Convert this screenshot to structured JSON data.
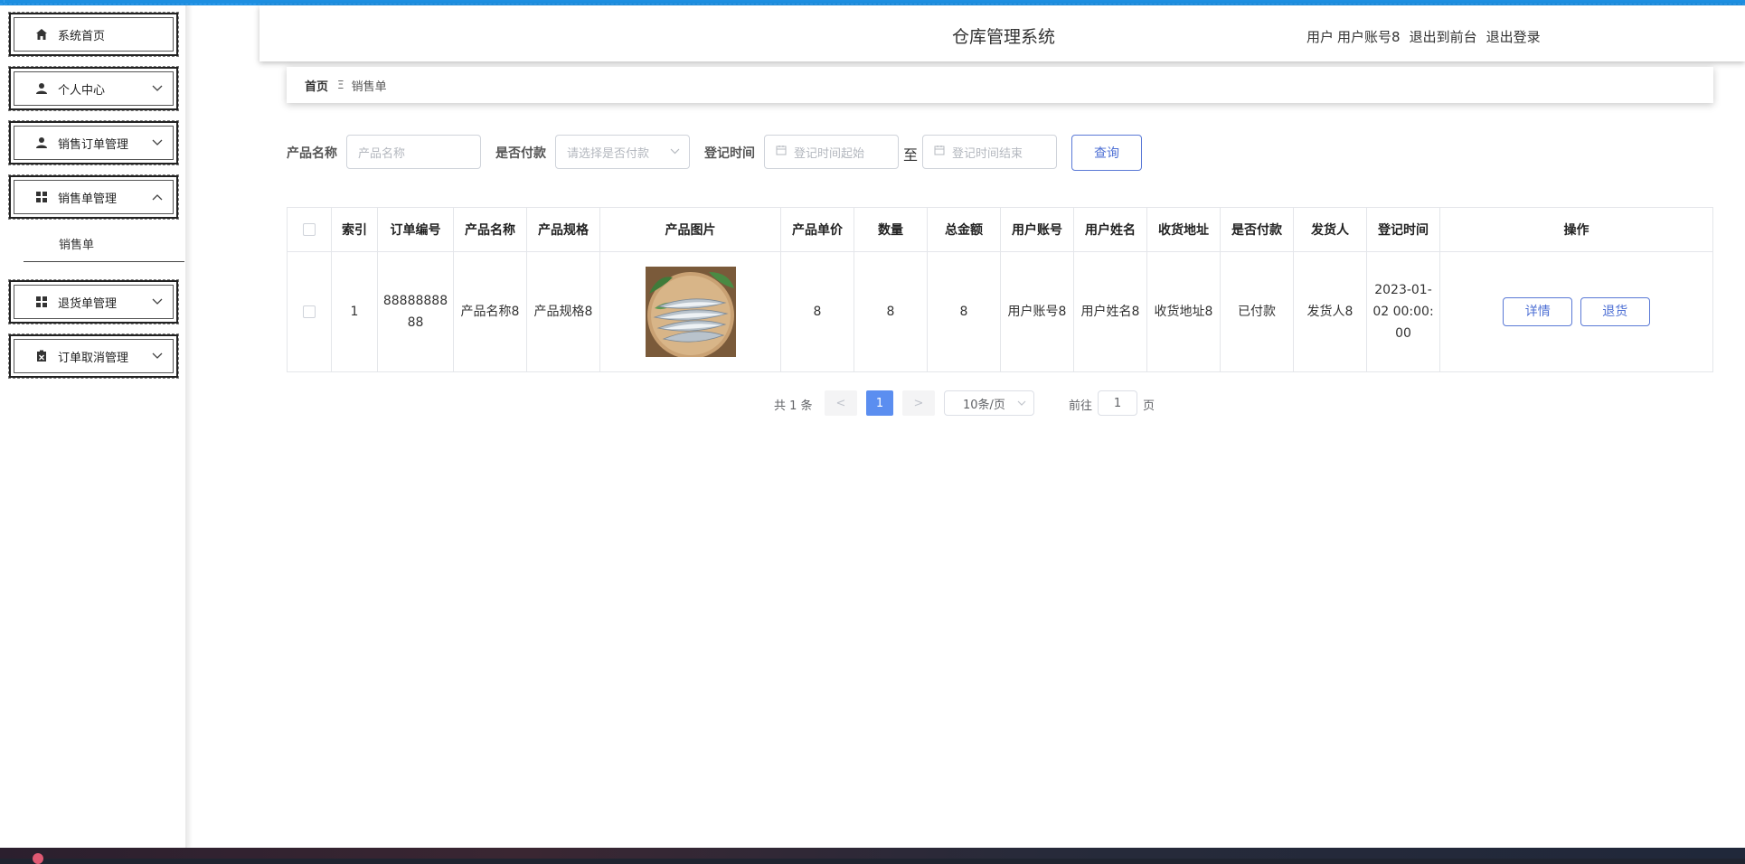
{
  "sidebar": {
    "items": [
      {
        "label": "系统首页",
        "icon": "home-icon",
        "has_chevron": false
      },
      {
        "label": "个人中心",
        "icon": "user-icon",
        "has_chevron": true
      },
      {
        "label": "销售订单管理",
        "icon": "user-icon",
        "has_chevron": true
      },
      {
        "label": "销售单管理",
        "icon": "grid-icon",
        "has_chevron": true,
        "expanded": true
      },
      {
        "label": "退货单管理",
        "icon": "grid-icon",
        "has_chevron": true
      },
      {
        "label": "订单取消管理",
        "icon": "cancel-box-icon",
        "has_chevron": true
      }
    ],
    "submenu": {
      "label": "销售单"
    }
  },
  "header": {
    "title": "仓库管理系统",
    "user_prefix": "用户",
    "username": "用户账号8",
    "exit_front": "退出到前台",
    "logout": "退出登录"
  },
  "breadcrumb": {
    "home": "首页",
    "separator": "Ξ",
    "current": "销售单"
  },
  "search": {
    "product_name_label": "产品名称",
    "product_name_placeholder": "产品名称",
    "paid_label": "是否付款",
    "paid_placeholder": "请选择是否付款",
    "time_label": "登记时间",
    "time_start_placeholder": "登记时间起始",
    "to_label": "至",
    "time_end_placeholder": "登记时间结束",
    "query_button": "查询"
  },
  "table": {
    "headers": [
      "",
      "索引",
      "订单编号",
      "产品名称",
      "产品规格",
      "产品图片",
      "产品单价",
      "数量",
      "总金额",
      "用户账号",
      "用户姓名",
      "收货地址",
      "是否付款",
      "发货人",
      "登记时间",
      "操作"
    ],
    "rows": [
      {
        "index": "1",
        "order_no": "8888888888",
        "product_name": "产品名称8",
        "product_spec": "产品规格8",
        "product_image": "fish-photo",
        "unit_price": "8",
        "quantity": "8",
        "total": "8",
        "user_account": "用户账号8",
        "user_name": "用户姓名8",
        "address": "收货地址8",
        "paid": "已付款",
        "shipper": "发货人8",
        "reg_time": "2023-01-02 00:00:00",
        "actions": {
          "detail": "详情",
          "return": "退货"
        }
      }
    ]
  },
  "pagination": {
    "total": "共 1 条",
    "prev": "<",
    "current_page": "1",
    "next": ">",
    "page_size": "10条/页",
    "goto_label": "前往",
    "goto_value": "1",
    "page_unit": "页"
  },
  "colors": {
    "accent": "#4d6fd4",
    "active_page": "#5b8ef0",
    "frame_blue": "#1d8fe1"
  }
}
